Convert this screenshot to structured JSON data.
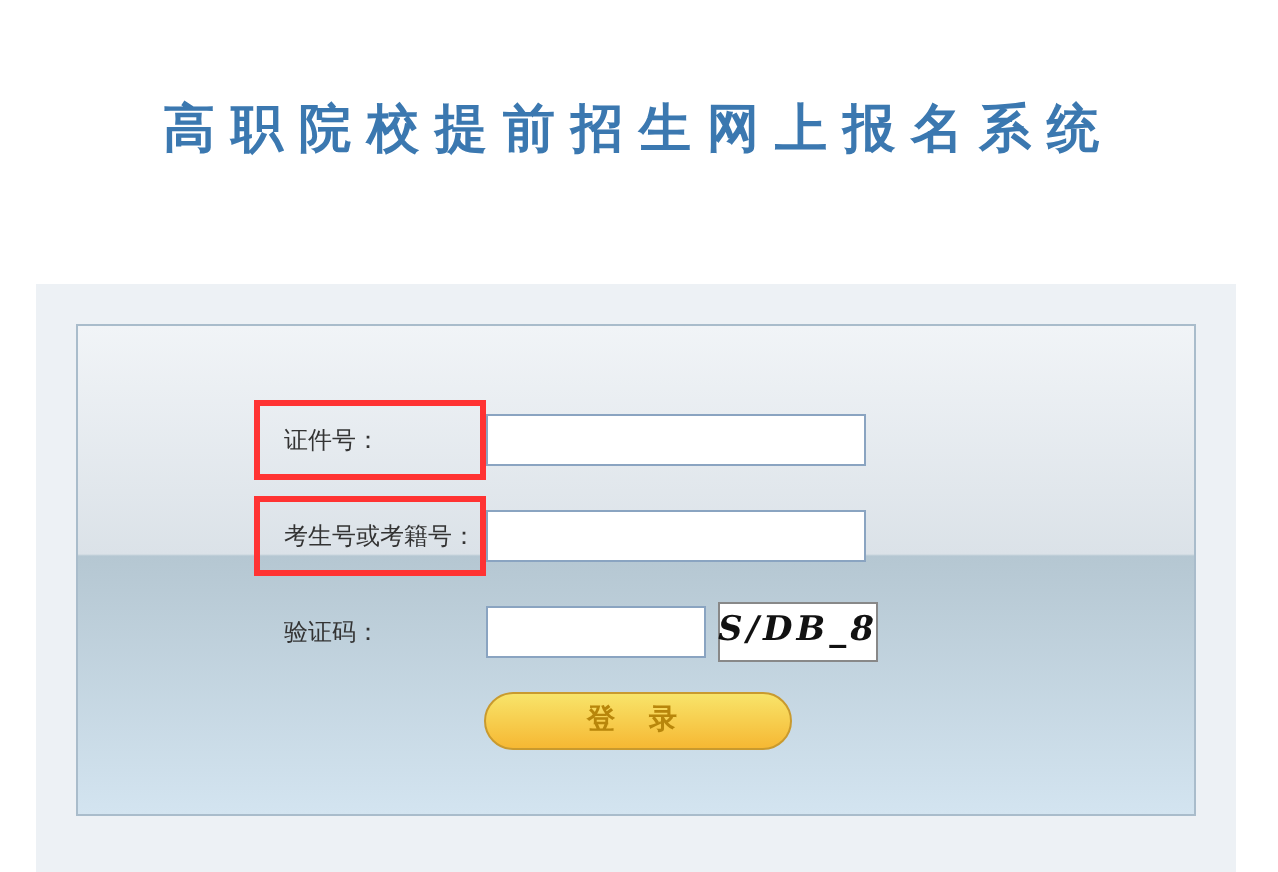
{
  "title": "高职院校提前招生网上报名系统",
  "fields": [
    {
      "label": "证件号：",
      "highlighted": true,
      "kind": "text"
    },
    {
      "label": "考生号或考籍号：",
      "highlighted": true,
      "kind": "text"
    },
    {
      "label": "验证码：",
      "highlighted": false,
      "kind": "captcha",
      "captcha": "S/DB_8"
    }
  ],
  "login_button": "登 录"
}
